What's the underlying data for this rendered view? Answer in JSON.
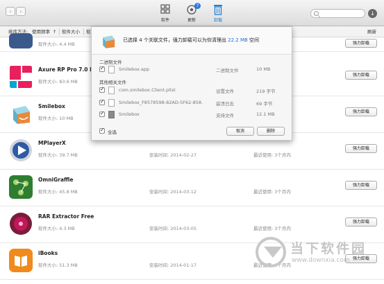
{
  "toolbar": {
    "back": "‹",
    "forward": "›",
    "tabs": [
      {
        "label": "软件",
        "icon": "grid-icon",
        "active": false
      },
      {
        "label": "更新",
        "icon": "update-icon",
        "active": false,
        "badge": "7"
      },
      {
        "label": "卸载",
        "icon": "trash-icon",
        "active": true
      }
    ],
    "search_placeholder": "",
    "accent_color": "#1b7fd6"
  },
  "sortbar": {
    "sort_prefix": "排序方法:",
    "option1": "使用频率",
    "arrow": "↑",
    "option2": "软件大小",
    "option3": "软",
    "refresh": "刷新"
  },
  "apps": [
    {
      "name": "",
      "size": "软件大小: 4.4 MB",
      "installed": "",
      "recent": "",
      "button": "强力卸载"
    },
    {
      "name": "Axure RP Pro 7.0 Beta",
      "size": "软件大小: 83.6 MB",
      "installed": "",
      "recent": "",
      "button": "强力卸载"
    },
    {
      "name": "Smilebox",
      "size": "软件大小: 10 MB",
      "installed": "",
      "recent": "",
      "button": "强力卸载"
    },
    {
      "name": "MPlayerX",
      "size": "软件大小: 39.7 MB",
      "installed": "安装时间: 2014-02-27",
      "recent": "最近使用: 3个月内",
      "button": "强力卸载"
    },
    {
      "name": "OmniGraffle",
      "size": "软件大小: 45.8 MB",
      "installed": "安装时间: 2014-03-12",
      "recent": "最近使用: 3个月内",
      "button": "强力卸载"
    },
    {
      "name": "RAR Extractor Free",
      "size": "软件大小: 4.3 MB",
      "installed": "安装时间: 2014-03-05",
      "recent": "最近使用: 3个月内",
      "button": "强力卸载"
    },
    {
      "name": "iBooks",
      "size": "软件大小: 51.3 MB",
      "installed": "安装时间: 2014-01-17",
      "recent": "最近使用: 3个月内",
      "button": "强力卸载"
    }
  ],
  "popup": {
    "msg_pre": "已选择 4 个关联文件，强力卸载可以为你清理出",
    "msg_size": "22.2 MB",
    "msg_post": "空间",
    "section_binary": "二进制文件",
    "section_other": "其他相关文件",
    "files": [
      {
        "name": "Smilebox.app",
        "type": "二进制文件",
        "size": "10 MB"
      },
      {
        "name": "com.smilebox.Client.plist",
        "type": "设置文件",
        "size": "219 字节"
      },
      {
        "name": "Smilebox_F8578598-82AD-5F62-858…",
        "type": "崩溃日志",
        "size": "69 字节"
      },
      {
        "name": "Smilebox",
        "type": "支持文件",
        "size": "12.1 MB"
      }
    ],
    "select_all": "全选",
    "cancel": "取消",
    "delete": "删除"
  },
  "watermark": {
    "title": "当下软件园",
    "url": "www.downxia.com"
  }
}
